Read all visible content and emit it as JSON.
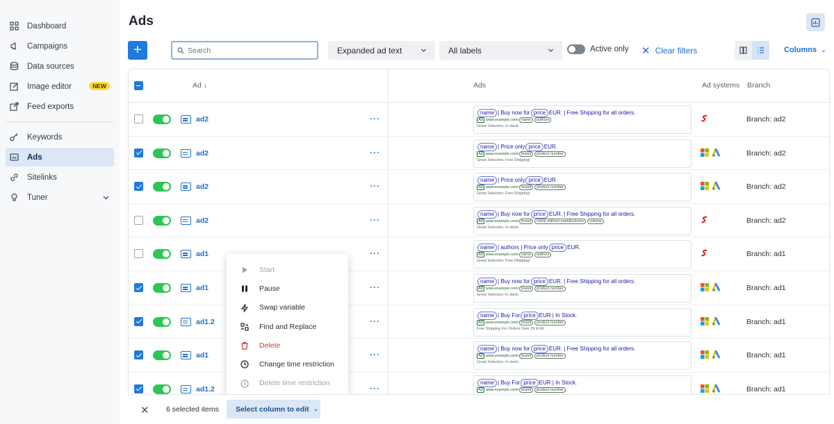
{
  "sidebar": {
    "items": [
      {
        "label": "Dashboard",
        "icon": "grid-icon"
      },
      {
        "label": "Campaigns",
        "icon": "megaphone-icon"
      },
      {
        "label": "Data sources",
        "icon": "database-icon"
      },
      {
        "label": "Image editor",
        "icon": "edit-image-icon",
        "badge": "NEW"
      },
      {
        "label": "Feed exports",
        "icon": "export-icon"
      },
      {
        "label": "Keywords",
        "icon": "key-icon"
      },
      {
        "label": "Ads",
        "icon": "ads-icon",
        "active": true
      },
      {
        "label": "Sitelinks",
        "icon": "link-icon"
      },
      {
        "label": "Tuner",
        "icon": "bulb-icon"
      }
    ]
  },
  "header": {
    "title": "Ads"
  },
  "toolbar": {
    "add_label": "+",
    "search_placeholder": "Search",
    "ad_type": "Expanded ad text",
    "labels": "All labels",
    "active_only": "Active only",
    "clear_filters": "Clear filters",
    "columns": "Columns"
  },
  "table": {
    "headers": {
      "ad": "Ad",
      "ads": "Ads",
      "systems": "Ad systems",
      "branch": "Branch"
    }
  },
  "rows": [
    {
      "checked": false,
      "name": "ad2",
      "systems": [
        "sklik"
      ],
      "branch": "Branch: ad2"
    },
    {
      "checked": true,
      "name": "ad2",
      "systems": [
        "microsoft",
        "google"
      ],
      "branch": "Branch: ad2"
    },
    {
      "checked": true,
      "name": "ad2",
      "systems": [
        "microsoft",
        "google"
      ],
      "branch": "Branch: ad2"
    },
    {
      "checked": false,
      "name": "ad2",
      "systems": [
        "sklik"
      ],
      "branch": "Branch: ad2"
    },
    {
      "checked": false,
      "name": "ad1",
      "systems": [
        "sklik"
      ],
      "branch": "Branch: ad1"
    },
    {
      "checked": true,
      "name": "ad1",
      "systems": [
        "microsoft",
        "google"
      ],
      "branch": "Branch: ad1"
    },
    {
      "checked": true,
      "name": "ad1.2",
      "systems": [
        "microsoft",
        "google"
      ],
      "branch": "Branch: ad1"
    },
    {
      "checked": true,
      "name": "ad1",
      "systems": [
        "microsoft",
        "google"
      ],
      "branch": "Branch: ad1"
    },
    {
      "checked": true,
      "name": "ad1.2",
      "systems": [
        "microsoft",
        "google"
      ],
      "branch": "Branch: ad1"
    }
  ],
  "previews": [
    {
      "h1a": "name",
      "h1b": "| Buy now for",
      "h1c": "price",
      "h1d": "EUR. | Free Shipping for all orders.",
      "url": "www.example.com/",
      "p1": "name",
      "p2": "authors",
      "p3": "",
      "desc": "Great Selection. In stock."
    },
    {
      "h1a": "name",
      "h1b": "| Price only",
      "h1c": "price",
      "h1d": "EUR.",
      "url": "www.example.com/",
      "p1": "brand",
      "p2": "product number",
      "p3": "",
      "desc": "Great Selection. Free Shipping!"
    },
    {
      "h1a": "name",
      "h1b": "| Price only",
      "h1c": "price",
      "h1d": "EUR.",
      "url": "www.example.com/",
      "p1": "brand",
      "p2": "product number",
      "p3": "",
      "desc": "Great Selection. Free Shipping!"
    },
    {
      "h1a": "name",
      "h1b": "| Buy now for",
      "h1c": "price",
      "h1d": "EUR. | Free Shipping for all orders.",
      "url": "www.example.com/",
      "p1": "brand",
      "p2": "name without mark&volume",
      "p3": "volume",
      "desc": "Great Selection. In stock."
    },
    {
      "h1a": "name",
      "h1b": "| authors | Price only",
      "h1c": "price",
      "h1d": "EUR.",
      "url": "www.example.com/",
      "p1": "name",
      "p2": "authors",
      "p3": "",
      "desc": "Great Selection. Free Shipping!"
    },
    {
      "h1a": "name",
      "h1b": "| Buy now for",
      "h1c": "price",
      "h1d": "EUR. | Free Shipping for all orders.",
      "url": "www.example.com/",
      "p1": "brand",
      "p2": "product number",
      "p3": "",
      "desc": "Great Selection. In stock."
    },
    {
      "h1a": "name",
      "h1b": "| Buy For",
      "h1c": "price",
      "h1d": "EUR | In Stock.",
      "url": "www.example.com/",
      "p1": "brand",
      "p2": "product number",
      "p3": "",
      "desc": "Free Shipping For Orders Over 29 EUR."
    },
    {
      "h1a": "name",
      "h1b": "| Buy now for",
      "h1c": "price",
      "h1d": "EUR. | Free Shipping for all orders.",
      "url": "www.example.com/",
      "p1": "brand",
      "p2": "product number",
      "p3": "",
      "desc": "Great Selection. In stock."
    },
    {
      "h1a": "name",
      "h1b": "| Buy For",
      "h1c": "price",
      "h1d": "EUR | In Stock.",
      "url": "www.example.com/",
      "p1": "brand",
      "p2": "product number",
      "p3": "",
      "desc": ""
    }
  ],
  "context_menu": {
    "items": [
      {
        "label": "Start",
        "icon": "play-icon",
        "disabled": true
      },
      {
        "label": "Pause",
        "icon": "pause-icon"
      },
      {
        "label": "Swap variable",
        "icon": "bolt-icon"
      },
      {
        "label": "Find and Replace",
        "icon": "find-replace-icon"
      },
      {
        "label": "Delete",
        "icon": "trash-icon",
        "danger": true
      },
      {
        "label": "Change time restriction",
        "icon": "clock-icon"
      },
      {
        "label": "Delete time restriction",
        "icon": "clock-icon",
        "disabled": true
      }
    ]
  },
  "bottom_bar": {
    "close": "✕",
    "selected": "6 selected items",
    "select_column": "Select column to edit"
  },
  "colors": {
    "accent": "#1f7ae0",
    "toggle_on": "#2ec653",
    "danger": "#d9362b"
  }
}
